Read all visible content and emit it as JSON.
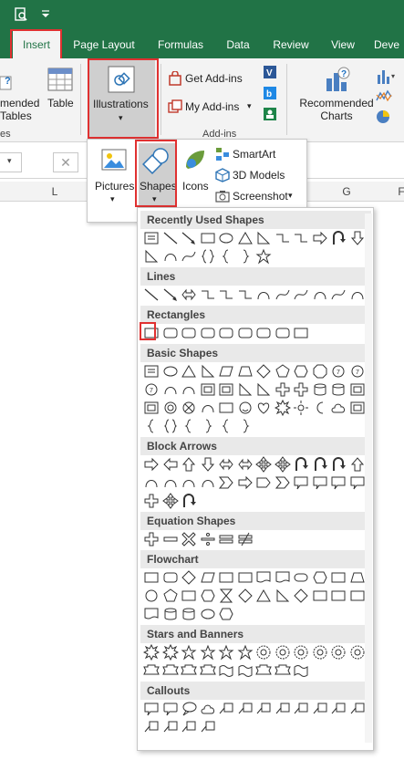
{
  "title_bar": {
    "qat_icons": [
      "print-preview-icon",
      "customize-qat-icon"
    ]
  },
  "tabs": [
    {
      "label": "Insert",
      "active": true
    },
    {
      "label": "Page Layout"
    },
    {
      "label": "Formulas"
    },
    {
      "label": "Data"
    },
    {
      "label": "Review"
    },
    {
      "label": "View"
    },
    {
      "label": "Deve"
    }
  ],
  "ribbon": {
    "recommended_tables_label": "mended\nTables",
    "tables_group_fragment": "es",
    "table_label": "Table",
    "illustrations_label": "Illustrations",
    "get_addins_label": "Get Add-ins",
    "my_addins_label": "My Add-ins",
    "addins_group_label": "Add-ins",
    "recommended_charts_label": "Recommended\nCharts"
  },
  "illustrations_menu": {
    "pictures_label": "Pictures",
    "shapes_label": "Shapes",
    "icons_label": "Icons",
    "smartart_label": "SmartArt",
    "models_label": "3D Models",
    "screenshot_label": "Screenshot"
  },
  "sheet": {
    "col_headers": [
      "L",
      "G",
      "F"
    ]
  },
  "shapes_gallery": {
    "sections": [
      {
        "title": "Recently Used Shapes"
      },
      {
        "title": "Lines"
      },
      {
        "title": "Rectangles"
      },
      {
        "title": "Basic Shapes"
      },
      {
        "title": "Block Arrows"
      },
      {
        "title": "Equation Shapes"
      },
      {
        "title": "Flowchart"
      },
      {
        "title": "Stars and Banners"
      },
      {
        "title": "Callouts"
      }
    ]
  },
  "colors": {
    "excel_green": "#217346",
    "highlight_red": "#e03131",
    "ribbon_bg": "#f3f3f3",
    "selected_gray": "#cfcfcf"
  }
}
